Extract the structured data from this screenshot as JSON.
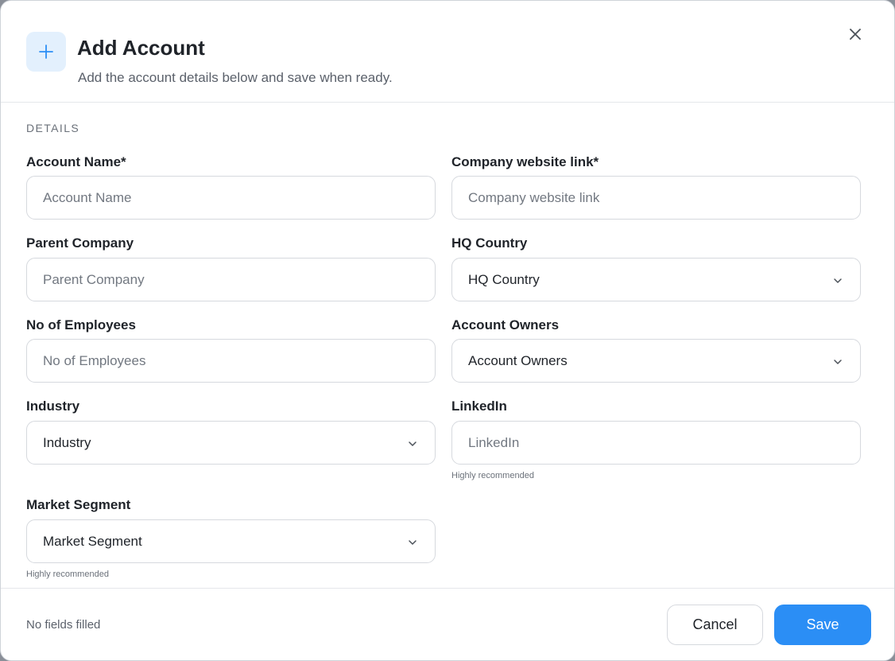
{
  "dialog": {
    "title": "Add Account",
    "subtitle": "Add the account details below and save when ready.",
    "section": "DETAILS"
  },
  "fields": {
    "account_name": {
      "label": "Account Name*",
      "placeholder": "Account Name"
    },
    "website": {
      "label": "Company website link*",
      "placeholder": "Company website link"
    },
    "parent_company": {
      "label": "Parent Company",
      "placeholder": "Parent Company"
    },
    "hq_country": {
      "label": "HQ Country",
      "value": "HQ Country"
    },
    "employees": {
      "label": "No of Employees",
      "placeholder": "No of Employees"
    },
    "account_owners": {
      "label": "Account Owners",
      "value": "Account Owners"
    },
    "industry": {
      "label": "Industry",
      "value": "Industry"
    },
    "linkedin": {
      "label": "LinkedIn",
      "placeholder": "LinkedIn",
      "hint": "Highly recommended"
    },
    "market_segment": {
      "label": "Market Segment",
      "value": "Market Segment",
      "hint": "Highly recommended"
    }
  },
  "footer": {
    "status": "No fields filled",
    "cancel_label": "Cancel",
    "save_label": "Save"
  },
  "colors": {
    "accent": "#2b8ef5",
    "icon_bg": "#e3f0fd"
  },
  "icons": {
    "header": "plus-icon",
    "close": "close-icon",
    "dropdown": "chevron-down-icon"
  }
}
